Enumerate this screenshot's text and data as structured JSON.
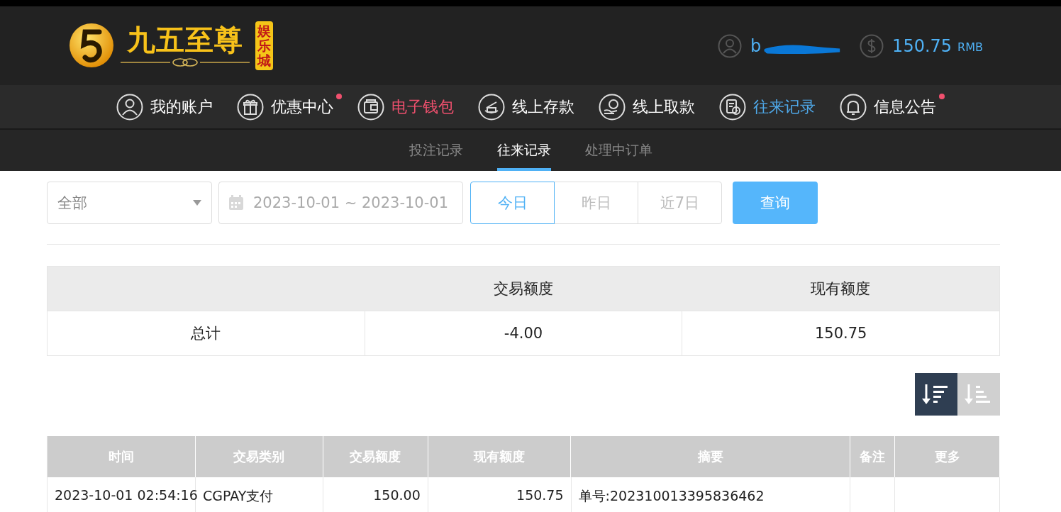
{
  "header": {
    "logo": {
      "title": "九五至尊",
      "badge": "娱乐城"
    },
    "user": {
      "name": "b",
      "redacted": true
    },
    "balance": {
      "amount": "150.75",
      "currency": "RMB"
    }
  },
  "nav": [
    {
      "label": "我的账户",
      "color": "#ffffff",
      "dot": false
    },
    {
      "label": "优惠中心",
      "color": "#ffffff",
      "dot": true
    },
    {
      "label": "电子钱包",
      "color": "#f0506e",
      "dot": false
    },
    {
      "label": "线上存款",
      "color": "#ffffff",
      "dot": false
    },
    {
      "label": "线上取款",
      "color": "#ffffff",
      "dot": false
    },
    {
      "label": "往来记录",
      "color": "#4fa9ea",
      "dot": false
    },
    {
      "label": "信息公告",
      "color": "#ffffff",
      "dot": true
    }
  ],
  "subtabs": [
    {
      "label": "投注记录",
      "selected": false
    },
    {
      "label": "往来记录",
      "selected": true
    },
    {
      "label": "处理中订单",
      "selected": false
    }
  ],
  "filters": {
    "type_select": {
      "value": "全部"
    },
    "date_range": {
      "value": "2023-10-01 ~ 2023-10-01"
    },
    "quick_ranges": [
      {
        "label": "今日",
        "selected": true
      },
      {
        "label": "昨日",
        "selected": false
      },
      {
        "label": "近7日",
        "selected": false
      }
    ],
    "query_button": "查询"
  },
  "summary": {
    "columns": [
      "",
      "交易额度",
      "现有额度"
    ],
    "rows": [
      [
        "总计",
        "-4.00",
        "150.75"
      ]
    ]
  },
  "sort_buttons": [
    {
      "selected": true
    },
    {
      "selected": false
    }
  ],
  "table": {
    "columns": [
      "时间",
      "交易类别",
      "交易额度",
      "现有额度",
      "摘要",
      "备注",
      "更多"
    ],
    "rows": [
      [
        "2023-10-01 02:54:16",
        "CGPAY支付",
        "150.00",
        "150.75",
        "单号:202310013395836462",
        "",
        ""
      ]
    ]
  }
}
